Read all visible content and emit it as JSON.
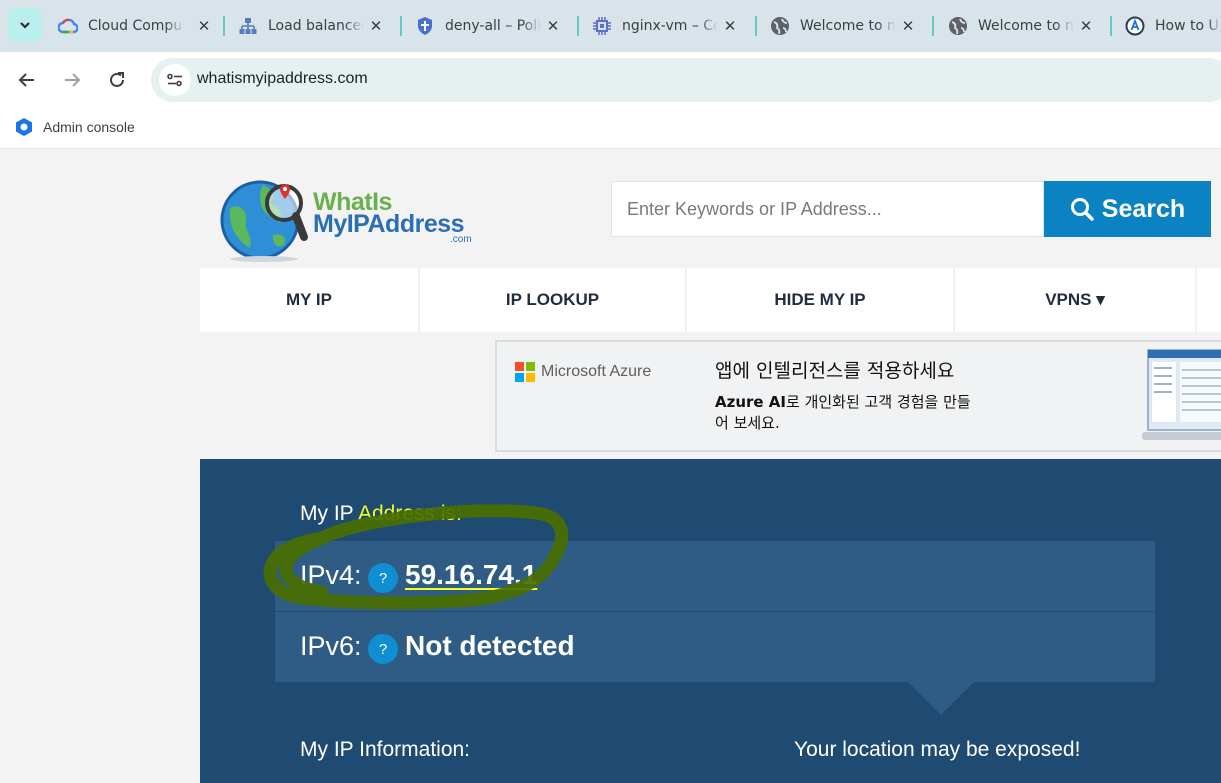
{
  "browser": {
    "tabs": [
      {
        "title": "Cloud Computing Services",
        "icon": "google-cloud-icon"
      },
      {
        "title": "Load balancers",
        "icon": "load-balancer-icon"
      },
      {
        "title": "deny-all – Policy",
        "icon": "shield-icon"
      },
      {
        "title": "nginx-vm – Compute",
        "icon": "chip-icon"
      },
      {
        "title": "Welcome to nginx",
        "icon": "globe-icon"
      },
      {
        "title": "Welcome to nginx",
        "icon": "globe-icon"
      },
      {
        "title": "How to Use",
        "icon": "app-icon"
      }
    ],
    "url": "whatismyipaddress.com",
    "bookmarks": [
      {
        "label": "Admin console",
        "icon": "admin-console-icon"
      }
    ]
  },
  "site": {
    "logo": {
      "line1": "WhatIs",
      "line2": "MyIPAddress",
      "suffix": ".com"
    },
    "search": {
      "placeholder": "Enter Keywords or IP Address...",
      "button_label": "Search"
    },
    "nav": [
      {
        "label": "MY IP"
      },
      {
        "label": "IP LOOKUP"
      },
      {
        "label": "HIDE MY IP"
      },
      {
        "label": "VPNS ▾"
      }
    ],
    "ad": {
      "brand": "Microsoft Azure",
      "headline": "앱에 인텔리전스를 적용하세요",
      "body_bold": "Azure AI",
      "body_rest": "로 개인화된 고객 경험을 만들어 보세요."
    },
    "ip_panel": {
      "label_prefix": "My IP",
      "label_highlight": "Address is:",
      "ipv4_label": "IPv4:",
      "ipv4_value": "59.16.74.1",
      "ipv6_label": "IPv6:",
      "ipv6_value": "Not detected",
      "help_glyph": "?",
      "info_heading": "My IP Information:",
      "exposed_heading": "Your location may be exposed!"
    }
  },
  "colors": {
    "accent": "#0b82c2",
    "panel": "#1f4b72",
    "row": "#2e5c84",
    "highlight": "#f4ff1c",
    "annotation": "#4a6e00"
  }
}
